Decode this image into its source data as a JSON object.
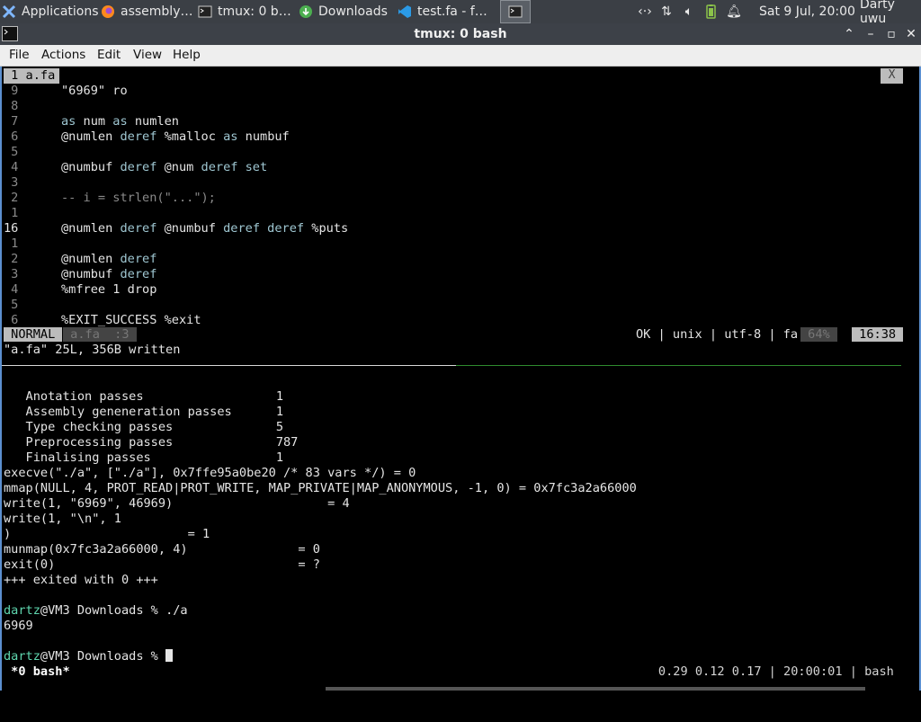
{
  "panel": {
    "tasks": [
      {
        "label": "Applications",
        "icon": "xfce-logo-icon",
        "trail": "☰"
      },
      {
        "label": "assembly…",
        "icon": "firefox-icon"
      },
      {
        "label": "tmux: 0 b…",
        "icon": "terminal-icon"
      },
      {
        "label": "Downloads",
        "icon": "download-icon"
      },
      {
        "label": "test.fa - f…",
        "icon": "vscode-icon"
      },
      {
        "label": "",
        "icon": "terminal-icon"
      }
    ],
    "tray": {
      "clock": "Sat  9 Jul, 20:00",
      "user": "Darty uwu"
    }
  },
  "window": {
    "title": "tmux: 0 bash"
  },
  "menubar": {
    "items": [
      "File",
      "Actions",
      "Edit",
      "View",
      "Help"
    ]
  },
  "vim": {
    "tab_label": " 1 a.fa ",
    "tab_close": "X",
    "lines": [
      {
        "num": " 9",
        "code": [
          {
            "t": "\"6969\" ro",
            "c": "plain"
          }
        ]
      },
      {
        "num": " 8",
        "code": []
      },
      {
        "num": " 7",
        "code": [
          {
            "t": "as",
            "c": "kw"
          },
          {
            "t": " num ",
            "c": "plain"
          },
          {
            "t": "as",
            "c": "kw"
          },
          {
            "t": " numlen",
            "c": "plain"
          }
        ]
      },
      {
        "num": " 6",
        "code": [
          {
            "t": "@numlen ",
            "c": "plain"
          },
          {
            "t": "deref",
            "c": "kw"
          },
          {
            "t": " %malloc ",
            "c": "plain"
          },
          {
            "t": "as",
            "c": "kw"
          },
          {
            "t": " numbuf",
            "c": "plain"
          }
        ]
      },
      {
        "num": " 5",
        "code": []
      },
      {
        "num": " 4",
        "code": [
          {
            "t": "@numbuf ",
            "c": "plain"
          },
          {
            "t": "deref",
            "c": "kw"
          },
          {
            "t": " @num ",
            "c": "plain"
          },
          {
            "t": "deref",
            "c": "kw"
          },
          {
            "t": " set",
            "c": "kw"
          }
        ]
      },
      {
        "num": " 3",
        "code": []
      },
      {
        "num": " 2",
        "code": [
          {
            "t": "-- i = strlen(\"...\");",
            "c": "cm"
          }
        ]
      },
      {
        "num": " 1",
        "code": []
      },
      {
        "num": "16",
        "code": [
          {
            "t": "@numlen ",
            "c": "plain"
          },
          {
            "t": "deref",
            "c": "kw"
          },
          {
            "t": " @numbuf ",
            "c": "plain"
          },
          {
            "t": "deref deref",
            "c": "kw"
          },
          {
            "t": " %puts",
            "c": "plain"
          }
        ],
        "current": true
      },
      {
        "num": " 1",
        "code": []
      },
      {
        "num": " 2",
        "code": [
          {
            "t": "@numlen ",
            "c": "plain"
          },
          {
            "t": "deref",
            "c": "kw"
          }
        ]
      },
      {
        "num": " 3",
        "code": [
          {
            "t": "@numbuf ",
            "c": "plain"
          },
          {
            "t": "deref",
            "c": "kw"
          }
        ]
      },
      {
        "num": " 4",
        "code": [
          {
            "t": "%mfree 1 drop",
            "c": "plain"
          }
        ]
      },
      {
        "num": " 5",
        "code": []
      },
      {
        "num": " 6",
        "code": [
          {
            "t": "%EXIT_SUCCESS %exit",
            "c": "plain"
          }
        ]
      }
    ],
    "status": {
      "mode": " NORMAL ",
      "file": " a.fa ",
      "pos": " :3 ",
      "info": "OK | unix | utf-8 | fa ",
      "percent": " 64% ",
      "time": " 16:38 "
    },
    "message": "\"a.fa\" 25L, 356B written"
  },
  "output": {
    "lines": [
      "",
      "   Anotation passes                  1",
      "   Assembly geneneration passes      1",
      "   Type checking passes              5",
      "   Preprocessing passes              787",
      "   Finalising passes                 1",
      "execve(\"./a\", [\"./a\"], 0x7ffe95a0be20 /* 83 vars */) = 0",
      "mmap(NULL, 4, PROT_READ|PROT_WRITE, MAP_PRIVATE|MAP_ANONYMOUS, -1, 0) = 0x7fc3a2a66000",
      "write(1, \"6969\", 46969)                     = 4",
      "write(1, \"\\n\", 1",
      ")                        = 1",
      "munmap(0x7fc3a2a66000, 4)               = 0",
      "exit(0)                                 = ?",
      "+++ exited with 0 +++",
      ""
    ],
    "prompt_user": "dartz",
    "prompt_rest": "@VM3 Downloads % ",
    "cmd": "./a",
    "result": "6969",
    "prompt2_user": "dartz",
    "prompt2_rest": "@VM3 Downloads % "
  },
  "tmux": {
    "window": " *0 bash*",
    "right": "0.29 0.12 0.17 | 20:00:01 | bash "
  },
  "colors": {
    "prompt_user": "#5fd7af",
    "keyword": "#9fc7d2",
    "status_mode_bg": "#bcbcbc"
  }
}
